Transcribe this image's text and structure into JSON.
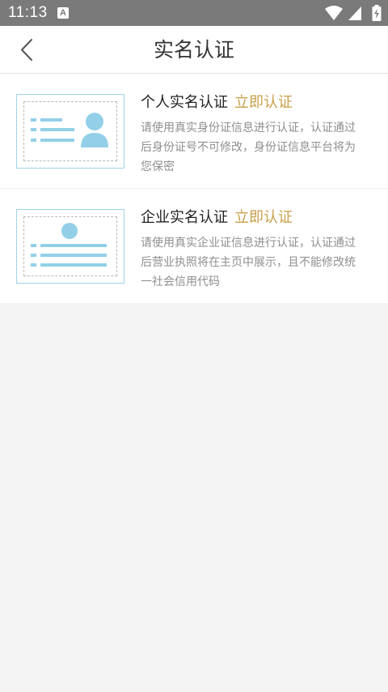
{
  "status_bar": {
    "time": "11:13",
    "notification_icon": "a-icon",
    "icons": [
      "wifi-icon",
      "signal-icon",
      "battery-charging-icon"
    ]
  },
  "header": {
    "back_icon": "chevron-left-icon",
    "title": "实名认证"
  },
  "items": [
    {
      "title": "个人实名认证",
      "action": "立即认证",
      "description": "请使用真实身份证信息进行认证，认证通过后身份证号不可修改，身份证信息平台将为您保密",
      "illustration": "id-card-icon"
    },
    {
      "title": "企业实名认证",
      "action": "立即认证",
      "description": "请使用真实企业证信息进行认证，认证通过后营业执照将在主页中展示，且不能修改统一社会信用代码",
      "illustration": "business-license-icon"
    }
  ],
  "colors": {
    "accent": "#c9a04a",
    "illustration": "#9ed3e8",
    "status_bar": "#7a7a7a",
    "background": "#f4f4f4"
  }
}
